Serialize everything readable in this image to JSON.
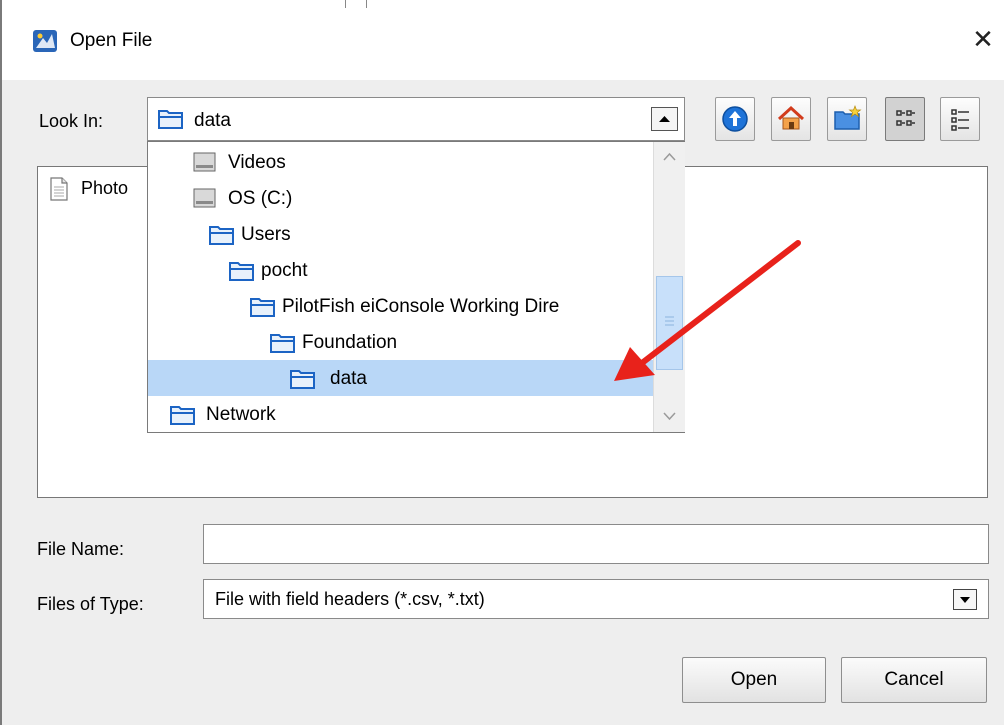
{
  "window": {
    "title": "Open File",
    "close_glyph": "✕"
  },
  "look_in": {
    "label": "Look In:",
    "selected": "data"
  },
  "toolbar": {
    "buttons": [
      "up-one-level",
      "home",
      "new-folder",
      "list-view",
      "details-view"
    ]
  },
  "file_list": {
    "items": [
      {
        "label": "Photo",
        "icon": "document-icon"
      }
    ]
  },
  "dropdown": {
    "items": [
      {
        "label": "Videos",
        "icon": "drive-icon"
      },
      {
        "label": "OS (C:)",
        "icon": "drive-icon"
      },
      {
        "label": "Users",
        "icon": "folder-icon"
      },
      {
        "label": "pocht",
        "icon": "folder-icon"
      },
      {
        "label": "PilotFish eiConsole Working Dire",
        "icon": "folder-icon"
      },
      {
        "label": "Foundation",
        "icon": "folder-icon"
      },
      {
        "label": "data",
        "icon": "folder-icon",
        "selected": true
      },
      {
        "label": "Network",
        "icon": "folder-icon"
      }
    ]
  },
  "file_name": {
    "label": "File Name:",
    "value": ""
  },
  "file_type": {
    "label": "Files of Type:",
    "selected": "File with field headers (*.csv, *.txt)"
  },
  "buttons": {
    "open": "Open",
    "cancel": "Cancel"
  },
  "colors": {
    "selection": "#b9d7f7",
    "annotation_arrow": "#e8221b"
  }
}
